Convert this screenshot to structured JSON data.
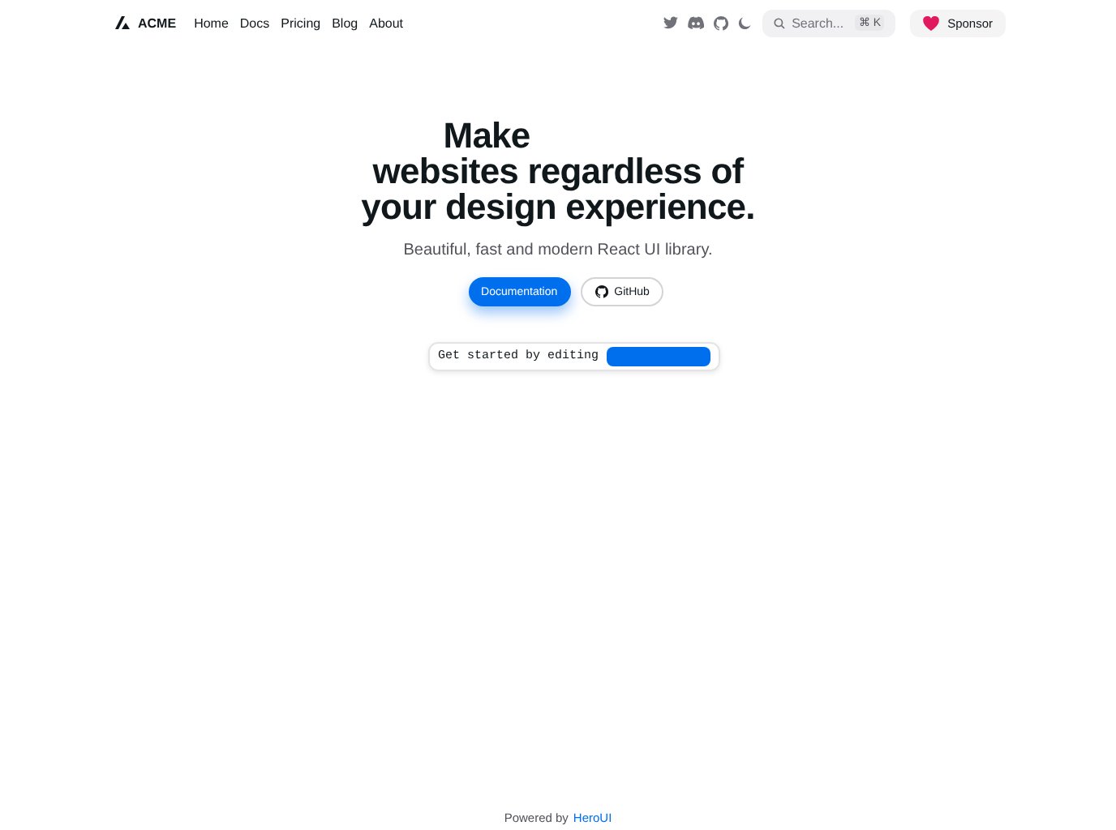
{
  "navbar": {
    "brand": "ACME",
    "links": [
      {
        "label": "Home"
      },
      {
        "label": "Docs"
      },
      {
        "label": "Pricing"
      },
      {
        "label": "Blog"
      },
      {
        "label": "About"
      }
    ],
    "search": {
      "placeholder": "Search...",
      "shortcut": "⌘ K"
    },
    "sponsor": "Sponsor"
  },
  "hero": {
    "title_lines": [
      "Make",
      "websites regardless of",
      "your design experience."
    ],
    "subtitle": "Beautiful, fast and modern React UI library.",
    "buttons": [
      {
        "label": "Documentation",
        "kind": "primary"
      },
      {
        "label": "GitHub",
        "kind": "outline"
      }
    ],
    "snippet": {
      "text": "Get started by editing"
    }
  },
  "footer": {
    "text": "Powered by",
    "link": "HeroUI"
  }
}
